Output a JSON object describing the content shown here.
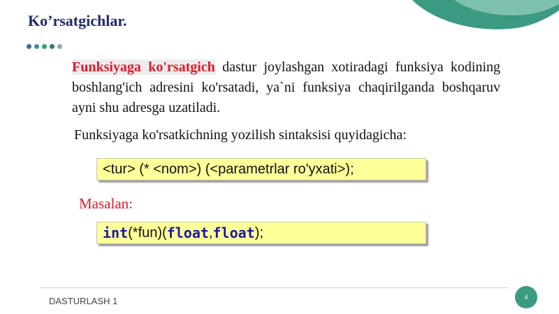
{
  "slide": {
    "title": "Ko’rsatgichlar.",
    "paragraph": {
      "highlight": "Funksiyaga ko'rsatgich",
      "rest": " dastur joylashgan xotiradagi funksiya kodining boshlang'ich adresini ko'rsatadi, ya`ni funksiya chaqirilganda boshqaruv ayni shu adresga uzatiladi."
    },
    "syntax_label": "Funksiyaga ko'rsatkichning yozilish sintaksisi quyidagicha:",
    "syntax_code": "<tur> (* <nom>) (<parametrlar ro'yxati>);",
    "example_label": "Masalan:",
    "example": {
      "kw_int": "int",
      "part1": " (*fun)(",
      "kw_float1": "float",
      "comma": ",",
      "kw_float2": "float",
      "part2": ");"
    },
    "footer": "DASTURLASH 1",
    "page_number": "4"
  },
  "colors": {
    "title": "#1f2a6b",
    "highlight": "#e0192b",
    "code_box": "#ffff99",
    "keyword": "#1a1aa6",
    "page_badge": "#3a9a82",
    "dots": [
      "#3a6f8f",
      "#3f8fa0",
      "#3a9a82",
      "#2f7d6a",
      "#8fa8a0"
    ]
  }
}
